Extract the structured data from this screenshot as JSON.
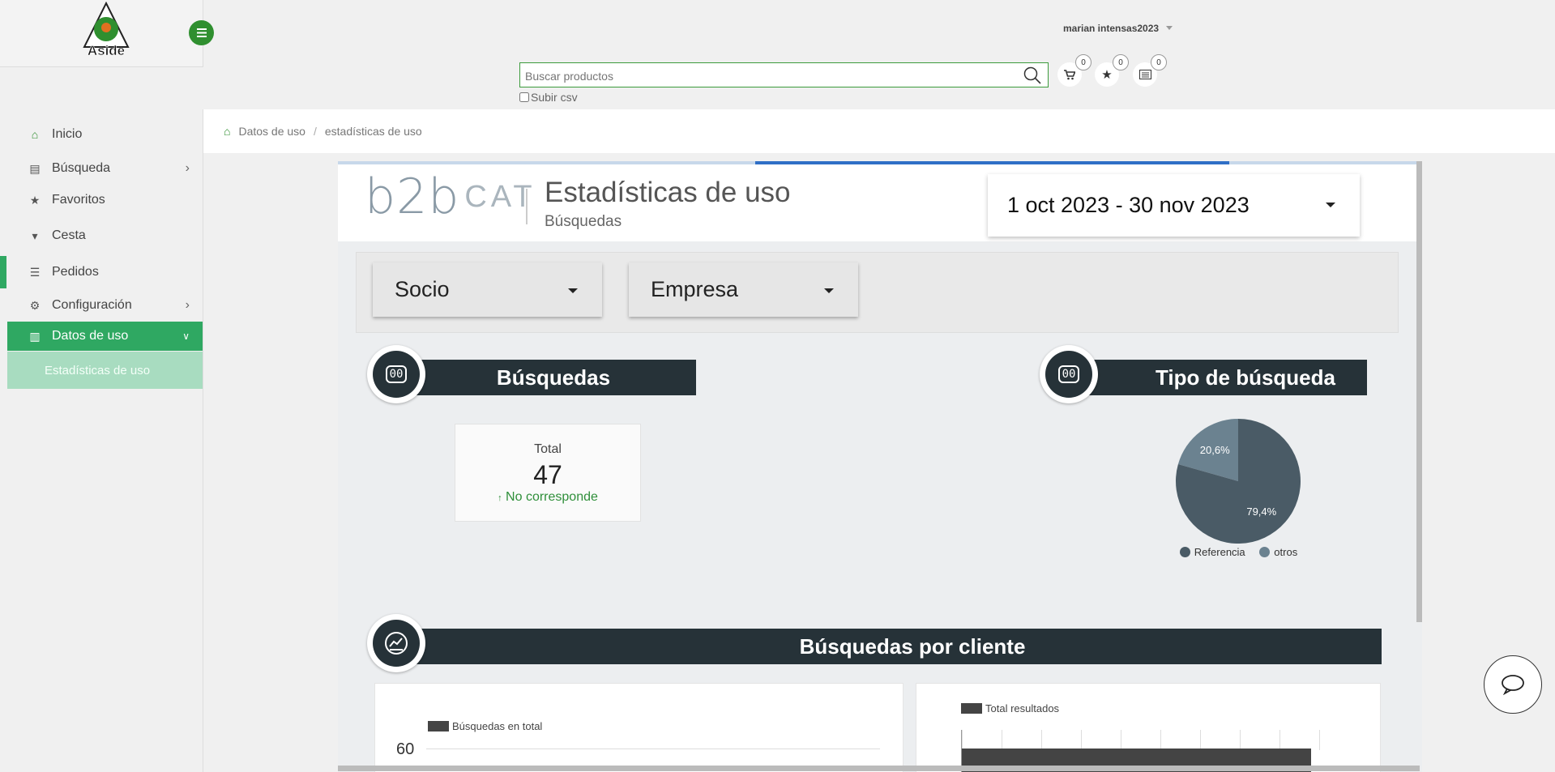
{
  "brand": {
    "logo_text": "Aside"
  },
  "user": {
    "name": "marian intensas2023"
  },
  "search": {
    "placeholder": "Buscar productos",
    "csv_label": "Subir csv"
  },
  "header_icons": [
    {
      "icon": "cart-icon",
      "count": "0"
    },
    {
      "icon": "star-icon",
      "count": "0"
    },
    {
      "icon": "list-icon",
      "count": "0"
    }
  ],
  "sidebar": {
    "items": [
      {
        "label": "Inicio",
        "icon": "home-icon"
      },
      {
        "label": "Búsqueda",
        "icon": "book-icon"
      },
      {
        "label": "Favoritos",
        "icon": "star-icon"
      },
      {
        "label": "Cesta",
        "icon": "cart-icon"
      },
      {
        "label": "Pedidos",
        "icon": "list-icon"
      },
      {
        "label": "Configuración",
        "icon": "gears-icon"
      },
      {
        "label": "Datos de uso",
        "icon": "bar-chart-icon"
      },
      {
        "label": "Estadísticas de uso"
      }
    ]
  },
  "breadcrumb": {
    "parent": "Datos de uso",
    "current": "estadísticas de uso"
  },
  "dashboard": {
    "brand_b": "b2b",
    "brand_cat": "CAT",
    "title": "Estadísticas de uso",
    "subtitle": "Búsquedas",
    "date_range": "1 oct 2023 - 30 nov 2023",
    "filters": {
      "socio": "Socio",
      "empresa": "Empresa"
    },
    "sections": {
      "busquedas": "Búsquedas",
      "tipo": "Tipo de búsqueda",
      "por_cliente": "Búsquedas por cliente"
    },
    "total": {
      "label": "Total",
      "value": "47",
      "trend_arrow": "↑",
      "trend": "No corresponde"
    },
    "pie": {
      "slices": [
        {
          "name": "Referencia",
          "label": "79,4%",
          "value": 79.4,
          "color": "#4a5b66"
        },
        {
          "name": "otros",
          "label": "20,6%",
          "value": 20.6,
          "color": "#6b8290"
        }
      ]
    },
    "chart1": {
      "legend": "Búsquedas en total",
      "y_tick": "60"
    },
    "chart2": {
      "legend": "Total resultados"
    }
  },
  "colors": {
    "accent": "#2fa862",
    "dark_bar": "#263238",
    "search_border": "#3c9b3c"
  }
}
